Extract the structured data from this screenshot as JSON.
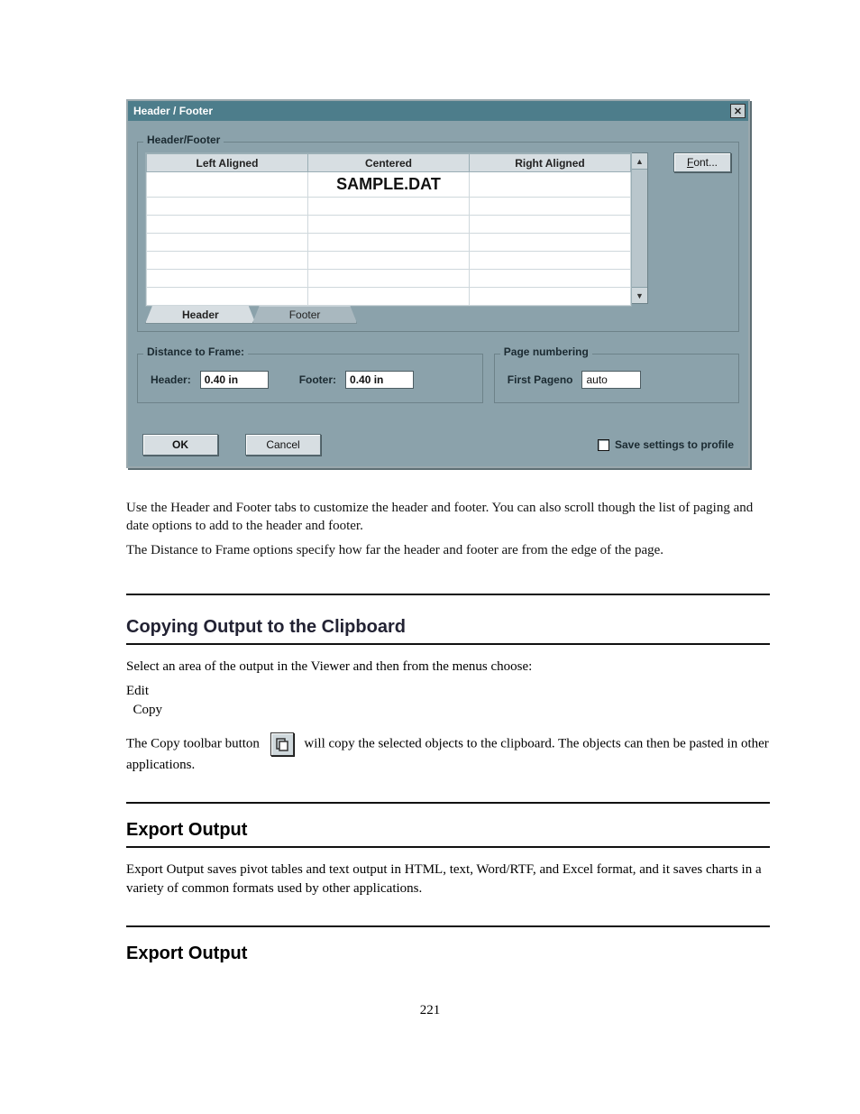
{
  "dialog": {
    "title": "Header / Footer",
    "close_glyph": "✕",
    "group_main": "Header/Footer",
    "columns": {
      "left": "Left Aligned",
      "center": "Centered",
      "right": "Right Aligned"
    },
    "sample_value": "SAMPLE.DAT",
    "font_button_prefix": "F",
    "font_button_rest": "ont...",
    "tabs": {
      "header": "Header",
      "footer": "Footer"
    },
    "distance": {
      "legend": "Distance to Frame:",
      "header_label": "Header:",
      "header_value": "0.40 in",
      "footer_label": "Footer:",
      "footer_value": "0.40 in"
    },
    "pageno": {
      "legend": "Page numbering",
      "label": "First Pageno",
      "value": "auto"
    },
    "ok": "OK",
    "cancel": "Cancel",
    "save": "Save settings to profile"
  },
  "body": {
    "p1": "Use the Header and Footer tabs to customize the header and footer. You can also scroll though the list of paging and date options to add to the header and footer.",
    "p2": "The Distance to Frame options specify how far the header and footer are from the edge of the page.",
    "h_clipboard": "Copying Output to the Clipboard",
    "p3": "Select an area of the output in the Viewer and then from the menus choose:",
    "p4a": "Edit",
    "p4b": "Copy",
    "p5_pre": "The Copy toolbar button",
    "p5_post": "will copy the selected objects to the clipboard. The objects can then be pasted in other applications.",
    "h_export": "Export Output",
    "p6": "Export Output saves pivot tables and text output in HTML, text, Word/RTF, and Excel format, and it saves charts in a variety of common formats used by other applications.",
    "h_export2": "Export Output"
  },
  "page_number": "221"
}
